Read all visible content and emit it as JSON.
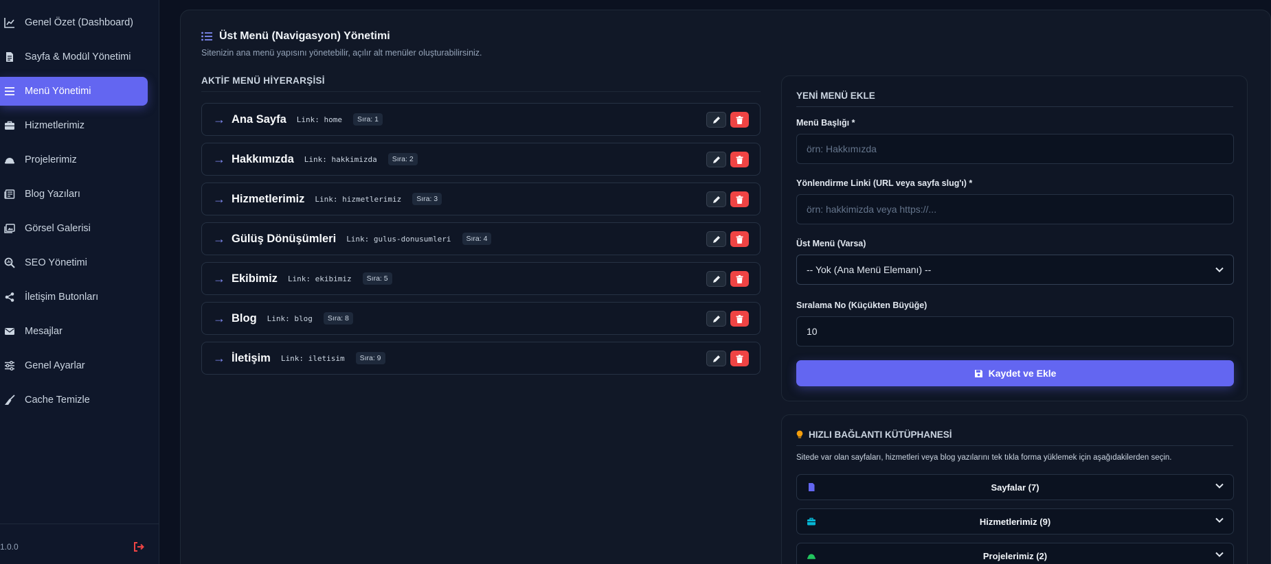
{
  "sidebar": {
    "items": [
      {
        "label": "Genel Özet (Dashboard)",
        "icon": "chart-line-icon"
      },
      {
        "label": "Sayfa & Modül Yönetimi",
        "icon": "file-icon"
      },
      {
        "label": "Menü Yönetimi",
        "icon": "bars-icon",
        "active": true
      },
      {
        "label": "Hizmetlerimiz",
        "icon": "briefcase-icon"
      },
      {
        "label": "Projelerimiz",
        "icon": "helmet-icon"
      },
      {
        "label": "Blog Yazıları",
        "icon": "newspaper-icon"
      },
      {
        "label": "Görsel Galerisi",
        "icon": "images-icon"
      },
      {
        "label": "SEO Yönetimi",
        "icon": "search-chart-icon"
      },
      {
        "label": "İletişim Butonları",
        "icon": "share-icon"
      },
      {
        "label": "Mesajlar",
        "icon": "envelope-icon"
      },
      {
        "label": "Genel Ayarlar",
        "icon": "sliders-icon"
      },
      {
        "label": "Cache Temizle",
        "icon": "broom-icon"
      }
    ],
    "version": "1.0.0"
  },
  "header": {
    "title": "Üst Menü (Navigasyon) Yönetimi",
    "subtitle": "Sitenizin ana menü yapısını yönetebilir, açılır alt menüler oluşturabilirsiniz."
  },
  "hierarchy": {
    "title": "AKTİF MENÜ HİYERARŞİSİ",
    "items": [
      {
        "name": "Ana Sayfa",
        "link": "Link: home",
        "order": "Sıra: 1"
      },
      {
        "name": "Hakkımızda",
        "link": "Link: hakkimizda",
        "order": "Sıra: 2"
      },
      {
        "name": "Hizmetlerimiz",
        "link": "Link: hizmetlerimiz",
        "order": "Sıra: 3"
      },
      {
        "name": "Gülüş Dönüşümleri",
        "link": "Link: gulus-donusumleri",
        "order": "Sıra: 4"
      },
      {
        "name": "Ekibimiz",
        "link": "Link: ekibimiz",
        "order": "Sıra: 5"
      },
      {
        "name": "Blog",
        "link": "Link: blog",
        "order": "Sıra: 8"
      },
      {
        "name": "İletişim",
        "link": "Link: iletisim",
        "order": "Sıra: 9"
      }
    ]
  },
  "form": {
    "title": "YENİ MENÜ EKLE",
    "title_label": "Menü Başlığı *",
    "title_placeholder": "örn: Hakkımızda",
    "link_label": "Yönlendirme Linki (URL veya sayfa slug'ı) *",
    "link_placeholder": "örn: hakkimizda veya https://...",
    "parent_label": "Üst Menü (Varsa)",
    "parent_value": "-- Yok (Ana Menü Elemanı) --",
    "order_label": "Sıralama No (Küçükten Büyüğe)",
    "order_value": "10",
    "save_label": "Kaydet ve Ekle"
  },
  "library": {
    "title": "HIZLI BAĞLANTI KÜTÜPHANESİ",
    "description": "Sitede var olan sayfaları, hizmetleri veya blog yazılarını tek tıkla forma yüklemek için aşağıdakilerden seçin.",
    "groups": [
      {
        "label": "Sayfalar (7)",
        "icon": "file-icon",
        "color": "#6366f1"
      },
      {
        "label": "Hizmetlerimiz (9)",
        "icon": "briefcase-icon",
        "color": "#06b6d4"
      },
      {
        "label": "Projelerimiz (2)",
        "icon": "helmet-icon",
        "color": "#22c55e"
      }
    ]
  },
  "colors": {
    "accent": "#6366f1",
    "danger": "#ef4444",
    "warning": "#f59e0b"
  }
}
